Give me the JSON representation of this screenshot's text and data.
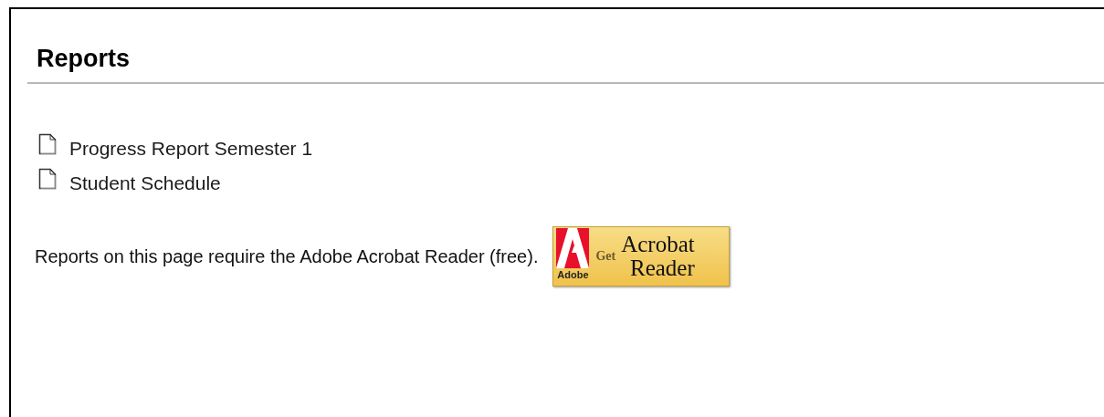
{
  "heading": "Reports",
  "reports": [
    {
      "label": "Progress Report Semester 1"
    },
    {
      "label": "Student Schedule"
    }
  ],
  "note": "Reports on this page require the Adobe Acrobat Reader (free).",
  "badge": {
    "brand": "Adobe",
    "verb": "Get",
    "line_1": "Acrobat",
    "line_2": "Reader"
  }
}
